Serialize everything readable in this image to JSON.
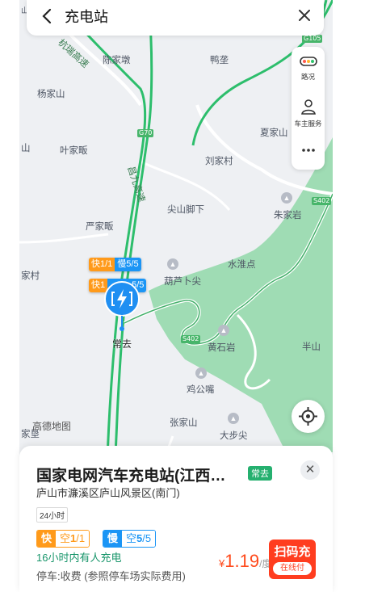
{
  "search": {
    "title": "充电站"
  },
  "side_tools": [
    {
      "label": "路况",
      "icon": "traffic-light-icon"
    },
    {
      "label": "车主服务",
      "icon": "user-icon"
    },
    {
      "label": "",
      "icon": "more-icon"
    }
  ],
  "map": {
    "labels": [
      "陈家墩",
      "鸭垄",
      "杨家山",
      "夏家山",
      "叶家畈",
      "刘家村",
      "严家畈",
      "尖山脚下",
      "朱家岩",
      "葫芦卜尖",
      "水淮点",
      "黄石岩",
      "半山",
      "鸡公嘴",
      "张家山",
      "大步尖",
      "山",
      "家村",
      "速",
      "家垦",
      "高德地图"
    ],
    "roads": [
      "杭瑞高速",
      "昌九高速"
    ],
    "shields": [
      "G70",
      "G105",
      "S402",
      "S402"
    ],
    "pin_label": "常去"
  },
  "map_tags": [
    {
      "fast_label": "快",
      "fast_value": "1/1",
      "slow_label": "慢",
      "slow_value": "5/5"
    },
    {
      "fast_label": "快",
      "fast_value": "1",
      "slow_label": "",
      "slow_value": "5/5"
    }
  ],
  "colors": {
    "fast": "#ff9a1a",
    "slow": "#1b95f5",
    "road": "#2dbe6c",
    "scan": "#ff3d1f"
  },
  "station": {
    "name": "国家电网汽车充电站(江西…",
    "badge": "常去",
    "address": "庐山市濂溪区庐山风景区(南门)",
    "hours": "24小时",
    "fast": {
      "label": "快",
      "status": "空",
      "count": "1",
      "total": "/1"
    },
    "slow": {
      "label": "慢",
      "status": "空",
      "count": "5",
      "total": "/5"
    },
    "activity": "16小时内有人充电",
    "parking": "停车:收费 (参照停车场实际费用)",
    "price_currency": "¥",
    "price_value": "1.19",
    "price_unit": "/度",
    "scan_label": "扫码充",
    "online_pay": "在线付"
  }
}
